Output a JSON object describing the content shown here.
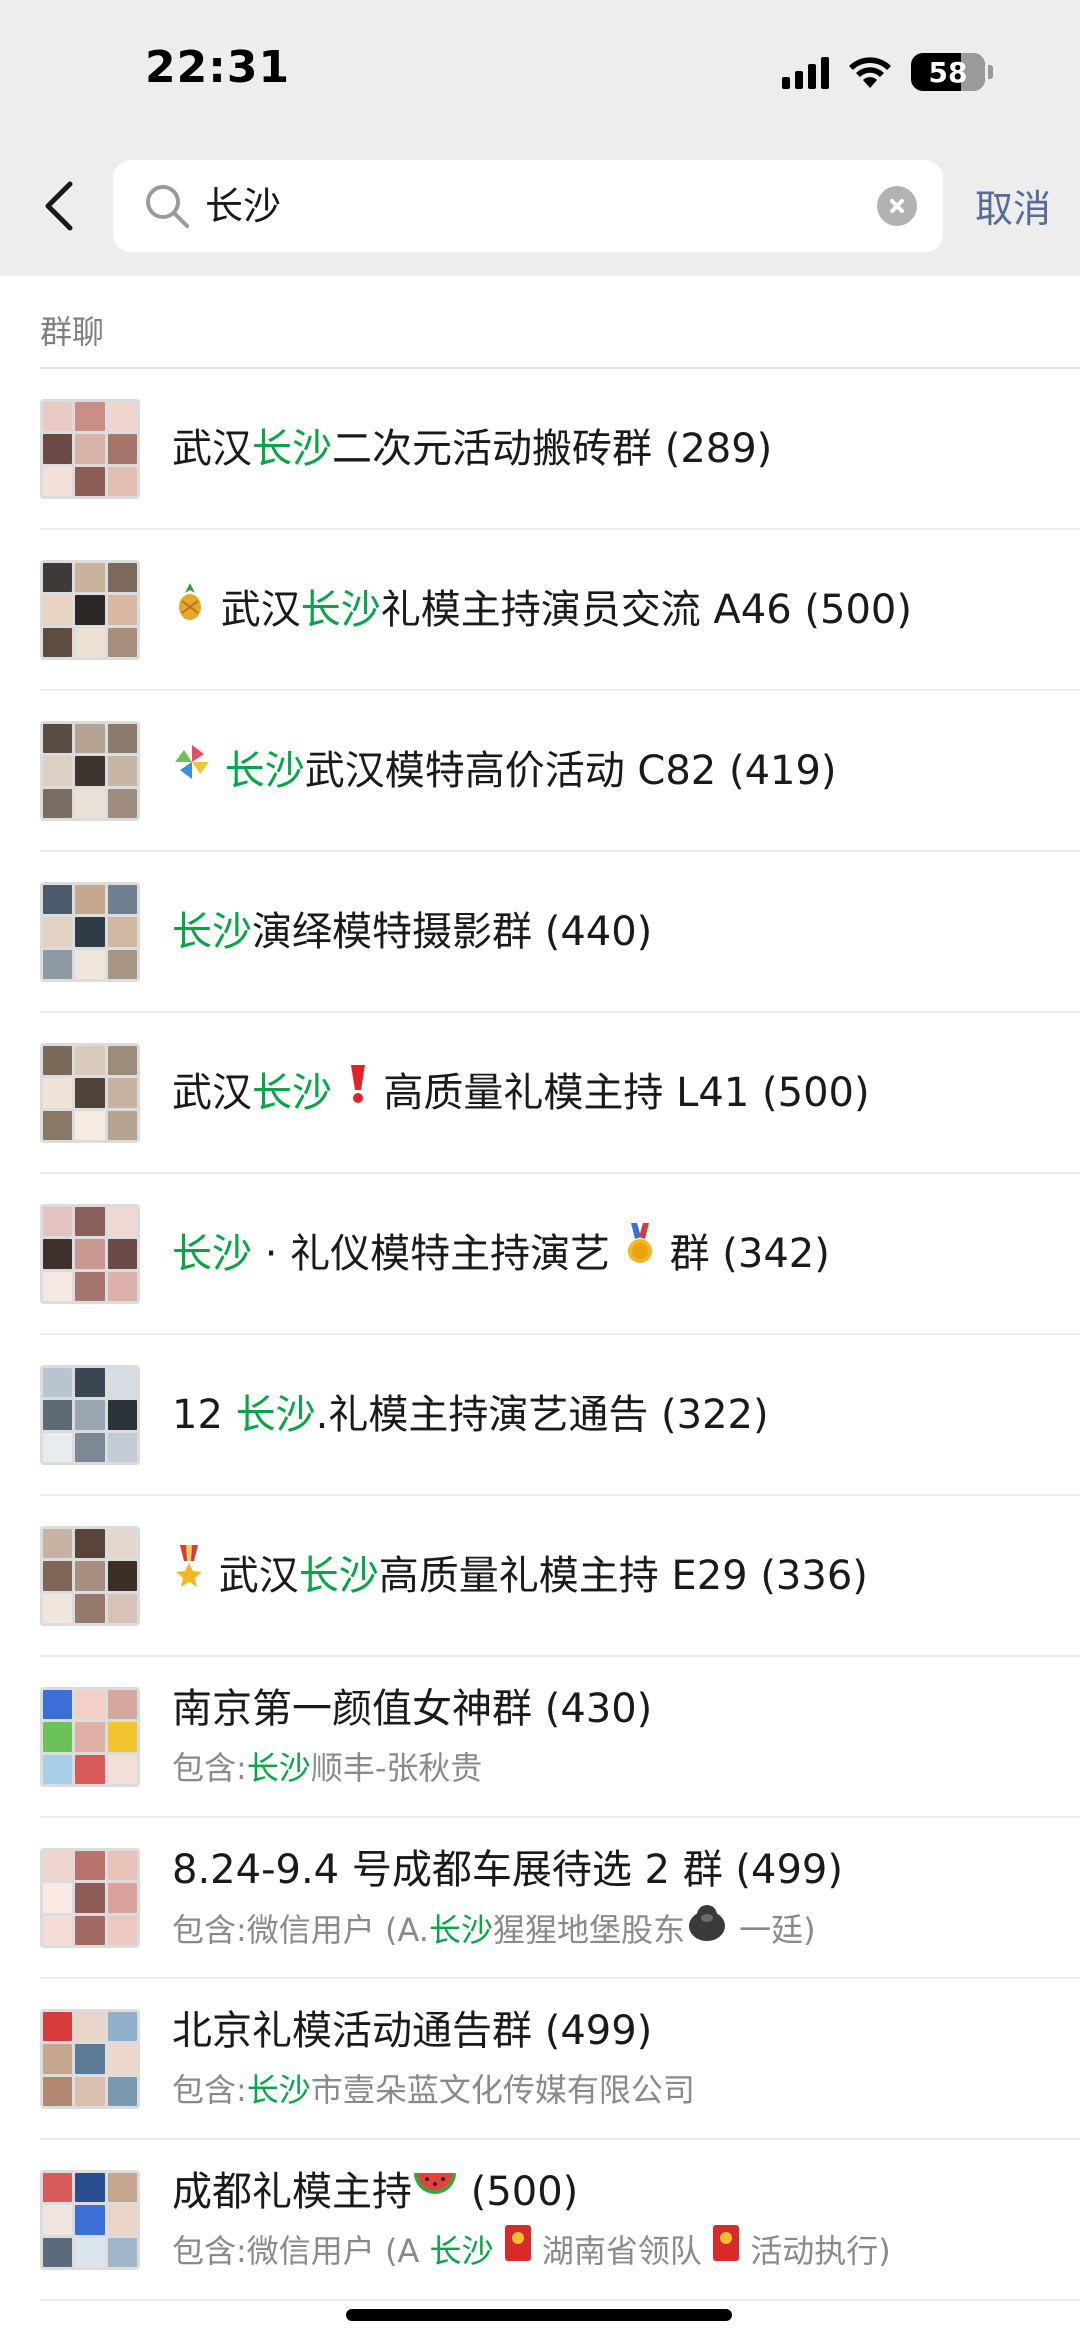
{
  "status_bar": {
    "time": "22:31",
    "battery": "58"
  },
  "search": {
    "query": "长沙",
    "cancel_label": "取消"
  },
  "section": {
    "label": "群聊"
  },
  "colors": {
    "highlight": "#07a548",
    "link": "#576b95",
    "header_bg": "#ededed"
  },
  "results": [
    {
      "title": [
        {
          "t": "武汉"
        },
        {
          "t": "长沙",
          "hl": true
        },
        {
          "t": "二次元活动搬砖群 (289)"
        }
      ]
    },
    {
      "title": [
        {
          "emoji": "pineapple"
        },
        {
          "t": " 武汉"
        },
        {
          "t": "长沙",
          "hl": true
        },
        {
          "t": "礼模主持演员交流 A46 (500)"
        }
      ]
    },
    {
      "title": [
        {
          "emoji": "pinwheel"
        },
        {
          "t": " "
        },
        {
          "t": "长沙",
          "hl": true
        },
        {
          "t": "武汉模特高价活动 C82 (419)"
        }
      ]
    },
    {
      "title": [
        {
          "t": "长沙",
          "hl": true
        },
        {
          "t": "演绎模特摄影群 (440)"
        }
      ]
    },
    {
      "title": [
        {
          "t": "武汉"
        },
        {
          "t": "长沙",
          "hl": true
        },
        {
          "t": " "
        },
        {
          "emoji": "exclamation"
        },
        {
          "t": " 高质量礼模主持 L41 (500)"
        }
      ]
    },
    {
      "title": [
        {
          "t": "长沙",
          "hl": true
        },
        {
          "t": " · 礼仪模特主持演艺 "
        },
        {
          "emoji": "medal"
        },
        {
          "t": " 群 (342)"
        }
      ]
    },
    {
      "title": [
        {
          "t": "12 "
        },
        {
          "t": "长沙",
          "hl": true
        },
        {
          "t": ".礼模主持演艺通告 (322)"
        }
      ]
    },
    {
      "title": [
        {
          "emoji": "military-medal"
        },
        {
          "t": " 武汉"
        },
        {
          "t": "长沙",
          "hl": true
        },
        {
          "t": "高质量礼模主持 E29 (336)"
        }
      ]
    },
    {
      "title": [
        {
          "t": "南京第一颜值女神群 (430)"
        }
      ],
      "sub": [
        {
          "t": "包含:"
        },
        {
          "t": "长沙",
          "hl": true
        },
        {
          "t": "顺丰-张秋贵"
        }
      ]
    },
    {
      "title": [
        {
          "t": "8.24-9.4 号成都车展待选 2 群 (499)"
        }
      ],
      "sub": [
        {
          "t": "包含:微信用户 (A."
        },
        {
          "t": "长沙",
          "hl": true
        },
        {
          "t": "猩猩地堡股东"
        },
        {
          "emoji": "gorilla"
        },
        {
          "t": " 一廷)"
        }
      ]
    },
    {
      "title": [
        {
          "t": "北京礼模活动通告群 (499)"
        }
      ],
      "sub": [
        {
          "t": "包含:"
        },
        {
          "t": "长沙",
          "hl": true
        },
        {
          "t": "市壹朵蓝文化传媒有限公司"
        }
      ]
    },
    {
      "title": [
        {
          "t": "成都礼模主持"
        },
        {
          "emoji": "watermelon"
        },
        {
          "t": " (500)"
        }
      ],
      "sub": [
        {
          "t": "包含:微信用户 (A "
        },
        {
          "t": "长沙",
          "hl": true
        },
        {
          "t": " "
        },
        {
          "emoji": "red-envelope"
        },
        {
          "t": " 湖南省领队 "
        },
        {
          "emoji": "red-envelope"
        },
        {
          "t": " 活动执行)"
        }
      ]
    }
  ]
}
